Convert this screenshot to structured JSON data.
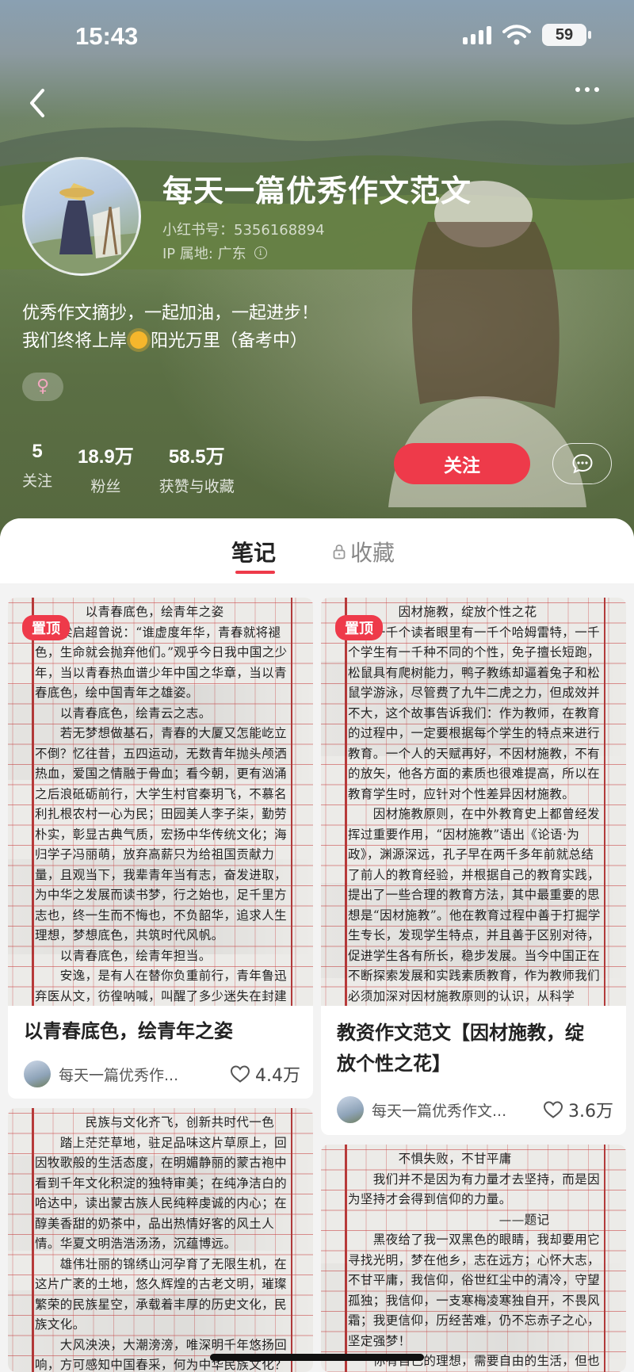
{
  "status_bar": {
    "time": "15:43",
    "battery": "59"
  },
  "profile": {
    "name": "每天一篇优秀作文范文",
    "id_line": "小红书号：5356168894",
    "ip_line": "IP 属地: 广东",
    "bio_line1": "优秀作文摘抄，一起加油，一起进步！",
    "bio_line2_before": "我们终将上岸",
    "bio_line2_after": "阳光万里（备考中）",
    "gender_symbol": "♀"
  },
  "stats": [
    {
      "value": "5",
      "label": "关注"
    },
    {
      "value": "18.9万",
      "label": "粉丝"
    },
    {
      "value": "58.5万",
      "label": "获赞与收藏"
    }
  ],
  "actions": {
    "follow": "关注"
  },
  "tabs": {
    "notes": "笔记",
    "favorites": "收藏"
  },
  "cards": [
    {
      "pinned": "置顶",
      "title": "以青春底色，绘青年之姿",
      "author": "每天一篇优秀作...",
      "likes": "4.4万",
      "handwriting": "　　　　以青春底色，绘青年之姿\n　　梁启超曾说：“谁虚度年华，青春就将褪色，生命就会抛弃他们。”观乎今日我中国之少年，当以青春热血谱少年中国之华章，当以青春底色，绘中国青年之雄姿。\n　　以青春底色，绘青云之志。\n　　若无梦想做基石，青春的大厦又怎能屹立不倒？忆往昔，五四运动，无数青年抛头颅洒热血，爱国之情融于骨血；看今朝，更有汹涌之后浪砥砺前行，大学生村官秦玥飞，不慕名利扎根农村一心为民；田园美人李子柒，勤劳朴实，彰显古典气质，宏扬中华传统文化；海归学子冯丽萌，放弃高薪只为给祖国贡献力量，且观当下，我辈青年当有志，奋发进取，为中华之发展而读书梦，行之始也，足千里方志也，终一生而不悔也，不负韶华，追求人生理想，梦想底色，共筑时代风帆。\n　　以青春底色，绘青年担当。\n　　安逸，是有人在替你负重前行，青年鲁迅弃医从文，彷徨呐喊，叫醒了多少迷失在封建"
    },
    {
      "pinned": "置顶",
      "title_line1": "教资作文范文【因材施教，绽",
      "title_line2": "放个性之花】",
      "author": "每天一篇优秀作文...",
      "likes": "3.6万",
      "handwriting": "　　　　因材施教，绽放个性之花\n　　一千个读者眼里有一千个哈姆雷特，一千个学生有一千种不同的个性，免子擅长短跑，松鼠具有爬树能力，鸭子教练却逼着兔子和松鼠学游泳，尽管费了九牛二虎之力，但成效并不大，这个故事告诉我们：作为教师，在教育的过程中，一定要根据每个学生的特点来进行教育。一个人的天赋再好，不因材施教，不有的放矢，他各方面的素质也很难提高，所以在教育学生时，应针对个性差异因材施教。\n　　因材施教原则，在中外教育史上都曾经发挥过重要作用，“因材施教”语出《论语·为政》，渊源深远，孔子早在两千多年前就总结了前人的教育经验，并根据自己的教育实践，提出了一些合理的教育方法，其中最重要的思想是“因材施教”。他在教育过程中善于打掘学生专长，发现学生特点，并且善于区别对待，促进学生各有所长，稳步发展。当今中国正在不断探索发展和实践素质教育，作为教师我们必须加深对因材施教原则的认识，从科学"
    },
    {
      "handwriting": "　　　　民族与文化齐飞，创新共时代一色\n　　踏上茫茫草地，驻足品味这片草原上，回因牧歌般的生活态度，在明媚静丽的蒙古袍中看到千年文化积淀的独特审美；在纯净洁白的哈达中，读出蒙古族人民纯粹虔诚的内心；在醇美香甜的奶茶中，品出热情好客的风土人情。华夏文明浩浩汤汤，沉蕴博远。\n　　雄伟壮丽的锦绣山河孕育了无限生机，在这片广袤的土地，悠久辉煌的古老文明，璀璨繁荣的民族星空，承载着丰厚的历史文化，民族文化。\n　　大风泱泱，大潮滂滂，唯深明千年悠扬回响，方可感知中国春采，何为中华民族文化？"
    },
    {
      "handwriting": "　　　　不惧失败，不甘平庸\n　　我们并不是因为有力量才去坚持，而是因为坚持才会得到信仰的力量。\n　　　　　　　　　　　　——题记\n　　黑夜给了我一双黑色的眼睛，我却要用它寻找光明，梦在他乡，志在远方；心怀大志，不甘平庸，我信仰，俗世红尘中的清冷，守望孤独；我信仰，一支寒梅凌寒独自开，不畏风霜；我更信仰，历经苦难，仍不忘赤子之心，坚定强梦！\n　　你有自己的理想，需要自由的生活，但也面临着"
    }
  ],
  "colors": {
    "accent": "#ee3a4a",
    "header_green": "#5b6f44",
    "grid_red": "#c23a3a"
  },
  "icons": [
    "back-arrow-icon",
    "more-dots-icon",
    "info-icon",
    "sun-icon",
    "female-icon",
    "chat-bubble-icon",
    "lock-icon",
    "heart-icon",
    "wifi-icon",
    "signal-icon",
    "battery-icon"
  ]
}
